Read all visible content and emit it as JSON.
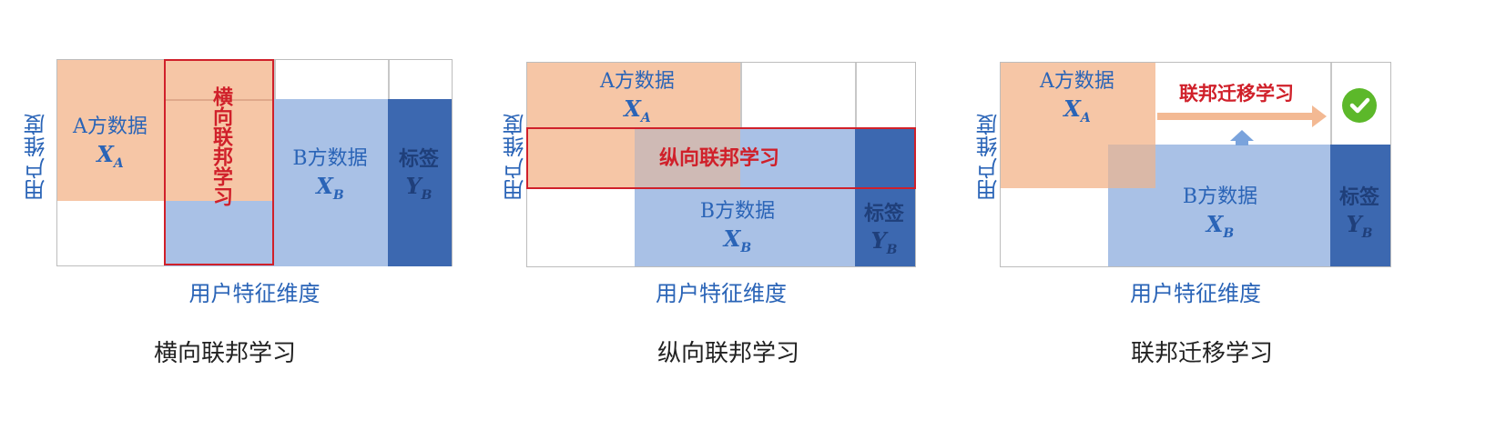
{
  "panels": [
    {
      "caption": "横向联邦学习",
      "x_axis": "用户特征维度",
      "y_axis": "用户维度",
      "a_label": "A方数据",
      "b_label": "B方数据",
      "label_block": "标签",
      "highlight": "横向联邦学习"
    },
    {
      "caption": "纵向联邦学习",
      "x_axis": "用户特征维度",
      "y_axis": "用户维度",
      "a_label": "A方数据",
      "b_label": "B方数据",
      "label_block": "标签",
      "highlight": "纵向联邦学习"
    },
    {
      "caption": "联邦迁移学习",
      "x_axis": "用户特征维度",
      "y_axis": "用户维度",
      "a_label": "A方数据",
      "b_label": "B方数据",
      "label_block": "标签",
      "highlight": "联邦迁移学习"
    }
  ],
  "math": {
    "xa_base": "X",
    "xa_sub": "A",
    "xb_base": "X",
    "xb_sub": "B",
    "yb_base": "Y",
    "yb_sub": "B"
  },
  "colors": {
    "party_a": "#f6c6a6",
    "party_b": "#a9c1e6",
    "label": "#3c68b0",
    "highlight": "#d0202a",
    "check": "#5cb82a"
  }
}
